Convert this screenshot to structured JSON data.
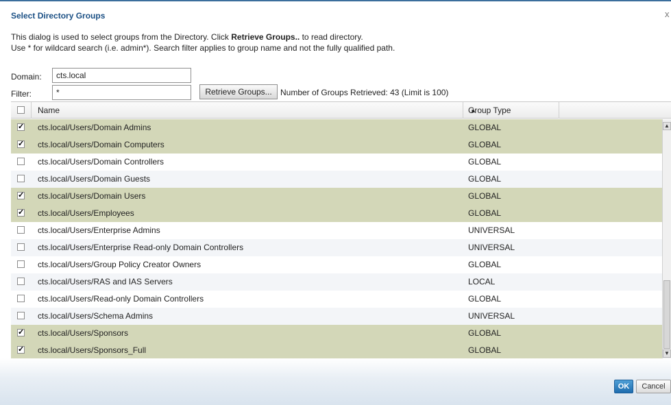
{
  "dialog": {
    "title": "Select Directory Groups",
    "close": "x",
    "desc_line1_pre": "This dialog is used to select groups from the Directory. Click ",
    "desc_line1_bold": "Retrieve Groups..",
    "desc_line1_post": " to read directory.",
    "desc_line2": "Use * for wildcard search (i.e. admin*). Search filter applies to group name and not the fully qualified path."
  },
  "form": {
    "domain_label": "Domain:",
    "domain_value": "cts.local",
    "filter_label": "Filter:",
    "filter_value": "*",
    "retrieve_button": "Retrieve Groups...",
    "retrieved_status": "Number of Groups Retrieved: 43 (Limit is 100)"
  },
  "table": {
    "col_name": "Name",
    "col_type": "Group Type",
    "sort_indicator": "▲",
    "rows": [
      {
        "name": "cts.local/Users/Domain Admins",
        "type": "GLOBAL",
        "checked": true
      },
      {
        "name": "cts.local/Users/Domain Computers",
        "type": "GLOBAL",
        "checked": true
      },
      {
        "name": "cts.local/Users/Domain Controllers",
        "type": "GLOBAL",
        "checked": false
      },
      {
        "name": "cts.local/Users/Domain Guests",
        "type": "GLOBAL",
        "checked": false
      },
      {
        "name": "cts.local/Users/Domain Users",
        "type": "GLOBAL",
        "checked": true
      },
      {
        "name": "cts.local/Users/Employees",
        "type": "GLOBAL",
        "checked": true
      },
      {
        "name": "cts.local/Users/Enterprise Admins",
        "type": "UNIVERSAL",
        "checked": false
      },
      {
        "name": "cts.local/Users/Enterprise Read-only Domain Controllers",
        "type": "UNIVERSAL",
        "checked": false
      },
      {
        "name": "cts.local/Users/Group Policy Creator Owners",
        "type": "GLOBAL",
        "checked": false
      },
      {
        "name": "cts.local/Users/RAS and IAS Servers",
        "type": "LOCAL",
        "checked": false
      },
      {
        "name": "cts.local/Users/Read-only Domain Controllers",
        "type": "GLOBAL",
        "checked": false
      },
      {
        "name": "cts.local/Users/Schema Admins",
        "type": "UNIVERSAL",
        "checked": false
      },
      {
        "name": "cts.local/Users/Sponsors",
        "type": "GLOBAL",
        "checked": true
      },
      {
        "name": "cts.local/Users/Sponsors_Full",
        "type": "GLOBAL",
        "checked": true
      }
    ]
  },
  "footer": {
    "ok": "OK",
    "cancel": "Cancel"
  },
  "colors": {
    "title": "#1a4f84",
    "selected_row": "#d3d7b8",
    "ok_button": "#1e6cae"
  }
}
